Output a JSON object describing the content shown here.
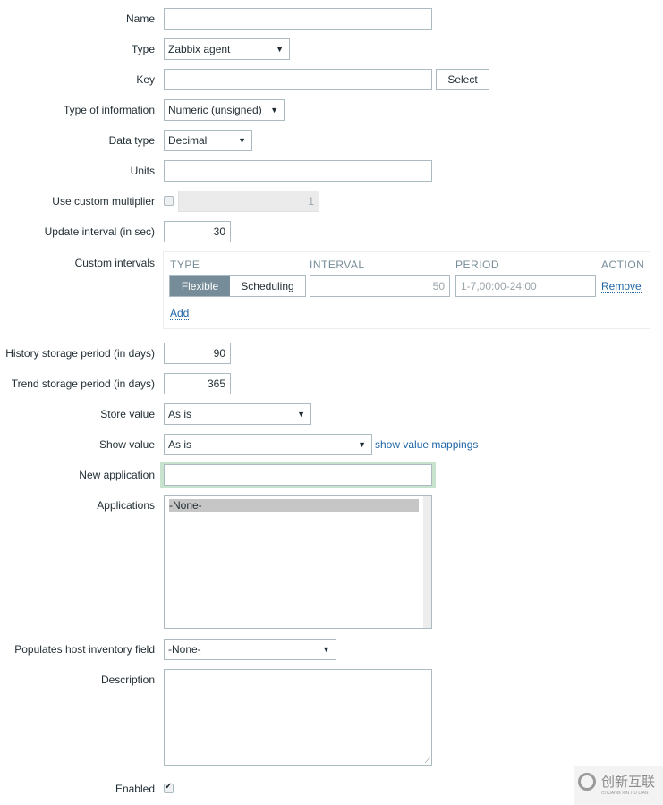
{
  "form": {
    "name": {
      "label": "Name",
      "value": ""
    },
    "type": {
      "label": "Type",
      "value": "Zabbix agent"
    },
    "key": {
      "label": "Key",
      "value": "",
      "select_button": "Select"
    },
    "type_of_information": {
      "label": "Type of information",
      "value": "Numeric (unsigned)"
    },
    "data_type": {
      "label": "Data type",
      "value": "Decimal"
    },
    "units": {
      "label": "Units",
      "value": ""
    },
    "custom_multiplier": {
      "label": "Use custom multiplier",
      "checked": false,
      "value": "1"
    },
    "update_interval": {
      "label": "Update interval (in sec)",
      "value": "30"
    },
    "custom_intervals": {
      "label": "Custom intervals",
      "headers": [
        "TYPE",
        "INTERVAL",
        "PERIOD",
        "ACTION"
      ],
      "rows": [
        {
          "type_options": [
            "Flexible",
            "Scheduling"
          ],
          "selected_type": "Flexible",
          "interval": "50",
          "period_placeholder": "1-7,00:00-24:00",
          "action": "Remove"
        }
      ],
      "add_label": "Add"
    },
    "history": {
      "label": "History storage period (in days)",
      "value": "90"
    },
    "trend": {
      "label": "Trend storage period (in days)",
      "value": "365"
    },
    "store_value": {
      "label": "Store value",
      "value": "As is"
    },
    "show_value": {
      "label": "Show value",
      "value": "As is",
      "link": "show value mappings"
    },
    "new_application": {
      "label": "New application",
      "value": ""
    },
    "applications": {
      "label": "Applications",
      "options": [
        "-None-"
      ],
      "selected": "-None-"
    },
    "inventory": {
      "label": "Populates host inventory field",
      "value": "-None-"
    },
    "description": {
      "label": "Description",
      "value": ""
    },
    "enabled": {
      "label": "Enabled",
      "checked": true
    }
  },
  "watermark": {
    "text": "创新互联",
    "subtext": "CHUANG XIN HU LIAN"
  },
  "colors": {
    "accent_selected": "#768d99",
    "link": "#1f65a6",
    "focus_border": "#c8e3cd"
  }
}
